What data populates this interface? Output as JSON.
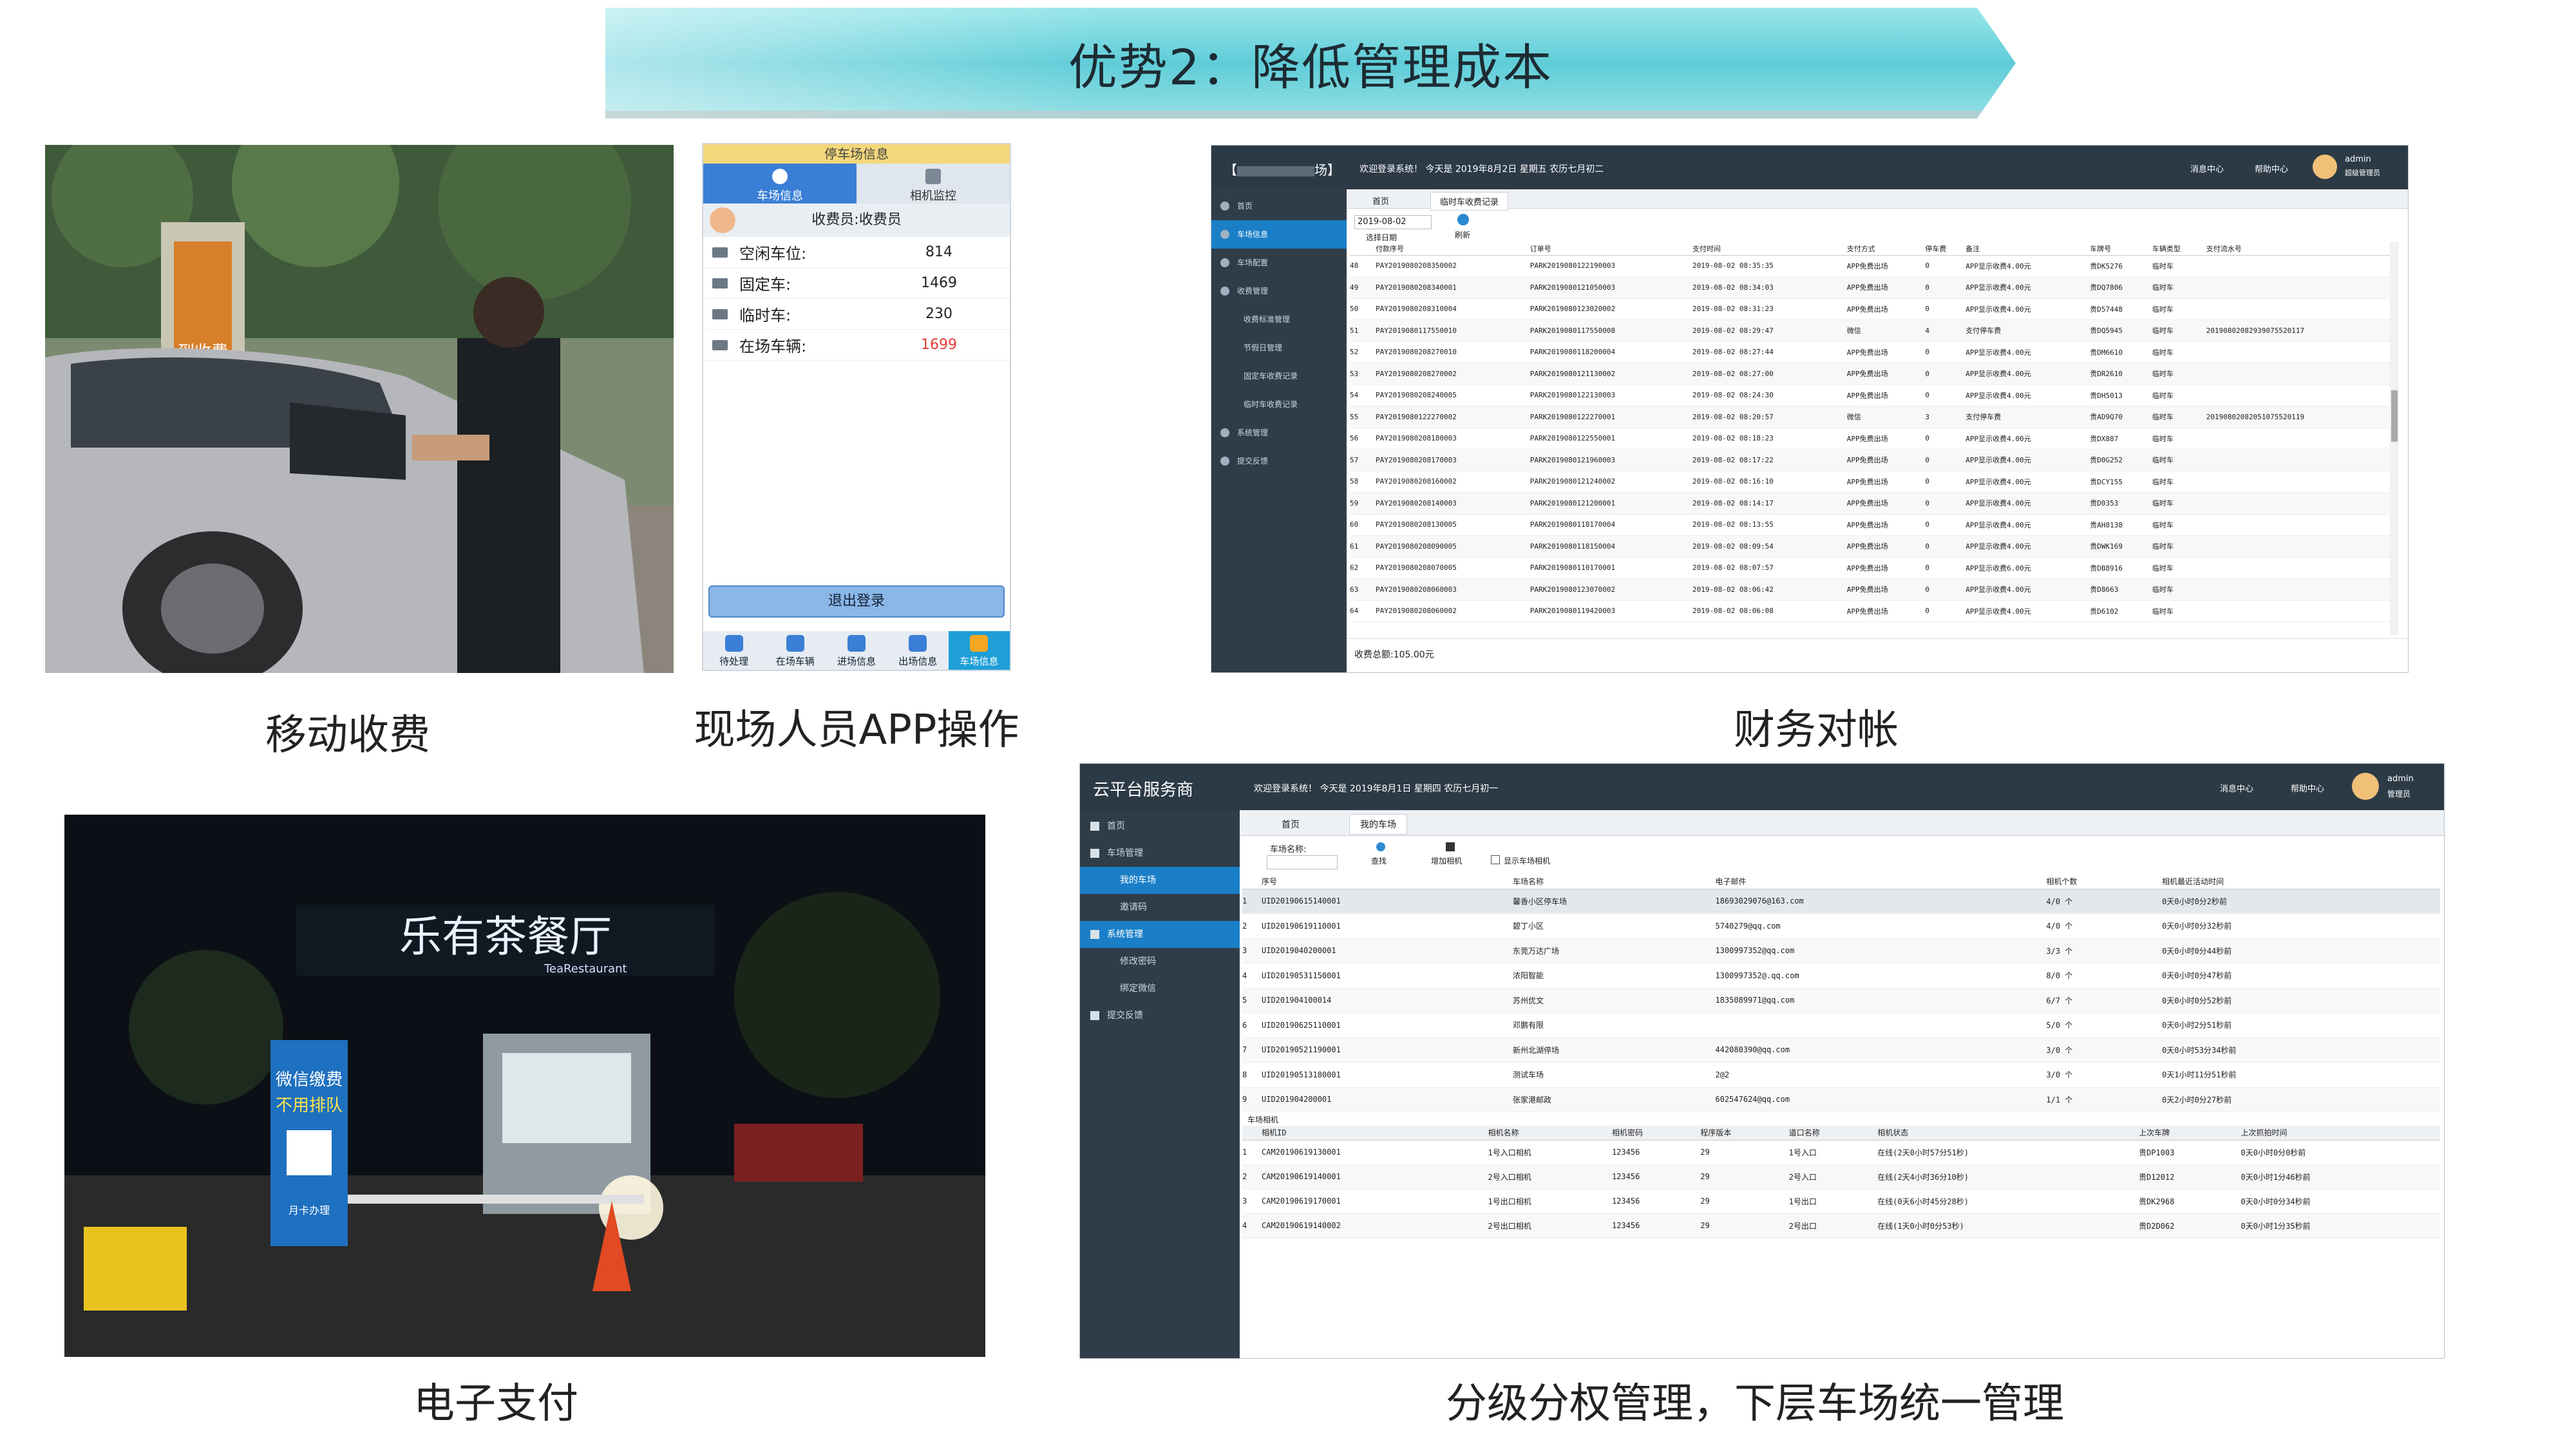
{
  "banner": {
    "title": "优势2：降低管理成本"
  },
  "captions": {
    "mobile_charging": "移动收费",
    "app_operation": "现场人员APP操作",
    "finance": "财务对帐",
    "e_payment": "电子支付",
    "hierarchy": "分级分权管理，下层车场统一管理"
  },
  "app": {
    "header": "停车场信息",
    "tabs": [
      "车场信息",
      "相机监控"
    ],
    "role": "收费员:收费员",
    "rows": [
      {
        "k": "空闲车位:",
        "v": "814"
      },
      {
        "k": "固定车:",
        "v": "1469"
      },
      {
        "k": "临时车:",
        "v": "230"
      },
      {
        "k": "在场车辆:",
        "v": "1699"
      }
    ],
    "logout": "退出登录",
    "nav": [
      "待处理",
      "在场车辆",
      "进场信息",
      "出场信息",
      "车场信息"
    ],
    "highlight_color": "#e53935"
  },
  "finance": {
    "title_suffix": "场】",
    "welcome": "欢迎登录系统！ 今天是 2019年8月2日 星期五 农历七月初二",
    "user": "admin",
    "user_role": "超级管理员",
    "top_links": [
      "消息中心",
      "帮助中心"
    ],
    "side": [
      "首页",
      "车场信息",
      "车场配置",
      "收费管理",
      "收费标准管理",
      "节假日管理",
      "固定车收费记录",
      "临时车收费记录",
      "系统管理",
      "提交反馈"
    ],
    "tabs": [
      "首页",
      "临时车收费记录"
    ],
    "date": "2019-08-02",
    "select_date": "选择日期",
    "refresh": "刷新",
    "columns": [
      "付款序号",
      "订单号",
      "支付时间",
      "支付方式",
      "停车费",
      "备注",
      "车牌号",
      "车辆类型",
      "支付流水号"
    ],
    "rows": [
      [
        "48",
        "PAY2019080208350002",
        "PARK2019080122190003",
        "2019-08-02 08:35:35",
        "APP免费出场",
        "0",
        "APP显示收费4.00元",
        "贵DK5276",
        "临时车",
        ""
      ],
      [
        "49",
        "PAY2019080208340001",
        "PARK2019080121050003",
        "2019-08-02 08:34:03",
        "APP免费出场",
        "0",
        "APP显示收费4.00元",
        "贵DQ7806",
        "临时车",
        ""
      ],
      [
        "50",
        "PAY2019080208310004",
        "PARK2019080123020002",
        "2019-08-02 08:31:23",
        "APP免费出场",
        "0",
        "APP显示收费4.00元",
        "贵D57448",
        "临时车",
        ""
      ],
      [
        "51",
        "PAY2019080117550010",
        "PARK2019080117550008",
        "2019-08-02 08:29:47",
        "微信",
        "4",
        "支付停车费",
        "贵DQ5945",
        "临时车",
        "20190802082939075520117"
      ],
      [
        "52",
        "PAY2019080208270010",
        "PARK2019080118200004",
        "2019-08-02 08:27:44",
        "APP免费出场",
        "0",
        "APP显示收费4.00元",
        "贵DM6610",
        "临时车",
        ""
      ],
      [
        "53",
        "PAY2019080208270002",
        "PARK2019080121130002",
        "2019-08-02 08:27:00",
        "APP免费出场",
        "0",
        "APP显示收费4.00元",
        "贵DR2610",
        "临时车",
        ""
      ],
      [
        "54",
        "PAY2019080208240005",
        "PARK2019080122130003",
        "2019-08-02 08:24:30",
        "APP免费出场",
        "0",
        "APP显示收费4.00元",
        "贵DH5013",
        "临时车",
        ""
      ],
      [
        "55",
        "PAY2019080122270002",
        "PARK2019080122270001",
        "2019-08-02 08:20:57",
        "微信",
        "3",
        "支付停车费",
        "贵AD9Q70",
        "临时车",
        "20190802082051075520119"
      ],
      [
        "56",
        "PAY2019080208180003",
        "PARK2019080122550001",
        "2019-08-02 08:18:23",
        "APP免费出场",
        "0",
        "APP显示收费4.00元",
        "贵DX887",
        "临时车",
        ""
      ],
      [
        "57",
        "PAY2019080208170003",
        "PARK2019080121960003",
        "2019-08-02 08:17:22",
        "APP免费出场",
        "0",
        "APP显示收费4.00元",
        "贵D0G252",
        "临时车",
        ""
      ],
      [
        "58",
        "PAY2019080208160002",
        "PARK2019080121240002",
        "2019-08-02 08:16:10",
        "APP免费出场",
        "0",
        "APP显示收费4.00元",
        "贵DCY155",
        "临时车",
        ""
      ],
      [
        "59",
        "PAY2019080208140003",
        "PARK2019080121200001",
        "2019-08-02 08:14:17",
        "APP免费出场",
        "0",
        "APP显示收费4.00元",
        "贵D0353",
        "临时车",
        ""
      ],
      [
        "60",
        "PAY2019080208130005",
        "PARK2019080118170004",
        "2019-08-02 08:13:55",
        "APP免费出场",
        "0",
        "APP显示收费4.00元",
        "贵AH8138",
        "临时车",
        ""
      ],
      [
        "61",
        "PAY2019080208090005",
        "PARK2019080118150004",
        "2019-08-02 08:09:54",
        "APP免费出场",
        "0",
        "APP显示收费4.00元",
        "贵DWK169",
        "临时车",
        ""
      ],
      [
        "62",
        "PAY2019080208070005",
        "PARK2019080110170001",
        "2019-08-02 08:07:57",
        "APP免费出场",
        "0",
        "APP显示收费6.00元",
        "贵DB8916",
        "临时车",
        ""
      ],
      [
        "63",
        "PAY2019080208060003",
        "PARK2019080123070002",
        "2019-08-02 08:06:42",
        "APP免费出场",
        "0",
        "APP显示收费4.00元",
        "贵D8663",
        "临时车",
        ""
      ],
      [
        "64",
        "PAY2019080208060002",
        "PARK2019080119420003",
        "2019-08-02 08:06:08",
        "APP免费出场",
        "0",
        "APP显示收费4.00元",
        "贵D6102",
        "临时车",
        ""
      ]
    ],
    "total": "收费总额:105.00元"
  },
  "cloud": {
    "brand": "云平台服务商",
    "welcome": "欢迎登录系统！ 今天是 2019年8月1日 星期四 农历七月初一",
    "user": "admin",
    "user_role": "管理员",
    "top_links": [
      "消息中心",
      "帮助中心"
    ],
    "side": [
      "首页",
      "车场管理",
      "我的车场",
      "邀请码",
      "系统管理",
      "修改密码",
      "绑定微信",
      "提交反馈"
    ],
    "tabs": [
      "首页",
      "我的车场"
    ],
    "search_label": "车场名称:",
    "btn_search": "查找",
    "btn_add_cam": "增加相机",
    "show_cam": "显示车场相机",
    "columns": [
      "序号",
      "车场名称",
      "电子邮件",
      "相机个数",
      "相机最近活动时间"
    ],
    "rows": [
      [
        "1",
        "UID2019061514000​1",
        "馨香小区停车场",
        "18693029076@163.com",
        "4/0 个",
        "0天0小时0分2秒前"
      ],
      [
        "2",
        "UID2019061911000​1",
        "碧丁小区",
        "5740279@qq.com",
        "4/0 个",
        "0天0小时0分32秒前"
      ],
      [
        "3",
        "UID2019040200001",
        "东莞万达广场",
        "1300997352@qq.com",
        "3/3 个",
        "0天0小时0分44秒前"
      ],
      [
        "4",
        "UID2019053115000​1",
        "浓阳智能",
        "1300997352@.qq.com",
        "8/0 个",
        "0天0小时0分47秒前"
      ],
      [
        "5",
        "UID2019041000​14",
        "苏州优文",
        "1835089971@qq.com",
        "6/7 个",
        "0天0小时0分52秒前"
      ],
      [
        "6",
        "UID2019062511000​1",
        "邓鹏有限",
        "",
        "5/0 个",
        "0天0小时2分51秒前"
      ],
      [
        "7",
        "UID2019052119000​1",
        "新州北湖停场",
        "442080390@qq.com",
        "3/0 个",
        "0天0小时53分34秒前"
      ],
      [
        "8",
        "UID2019051318000​1",
        "测试车场",
        "2@2",
        "3/0 个",
        "0天1小时11分51秒前"
      ],
      [
        "9",
        "UID2019042000​01",
        "张家港邮政",
        "602547624@qq.com",
        "1/1 个",
        "0天2小时0分27秒前"
      ]
    ],
    "cam_title": "车场相机",
    "cam_columns": [
      "相机ID",
      "相机名称",
      "相机密码",
      "程序版本",
      "道口名称",
      "相机状态",
      "上次车牌",
      "上次抓拍时间"
    ],
    "cam_rows": [
      [
        "1",
        "CAM2019061913000​1",
        "1号入口相机",
        "123456",
        "29",
        "1号入口",
        "在线(2天0小时57分51秒)",
        "贵DP1003",
        "0天0小时0分0秒前"
      ],
      [
        "2",
        "CAM2019061914000​1",
        "2号入口相机",
        "123456",
        "29",
        "2号入口",
        "在线(2天4小时36分10秒)",
        "贵D12012",
        "0天0小时1分46秒前"
      ],
      [
        "3",
        "CAM2019061917000​1",
        "1号出口相机",
        "123456",
        "29",
        "1号出口",
        "在线(0天6小时45分28秒)",
        "贵DK2968",
        "0天0小时0分34秒前"
      ],
      [
        "4",
        "CAM2019061914000​2",
        "2号出口相机",
        "123456",
        "29",
        "2号出口",
        "在线(1天0小时0分53秒)",
        "贵D2D062",
        "0天0小时1分35秒前"
      ]
    ]
  },
  "photos": {
    "top_booth_sign": "到收费",
    "restaurant_sign": "乐有茶餐厅",
    "restaurant_sub": "TeaRestaurant",
    "kiosk_title": "微信缴费",
    "kiosk_sub": "不用排队",
    "kiosk_foot": "月卡办理"
  },
  "colors": {
    "banner": "#6fd3dc",
    "admin_header": "#2c3a46",
    "admin_accent": "#1a7fc7"
  }
}
